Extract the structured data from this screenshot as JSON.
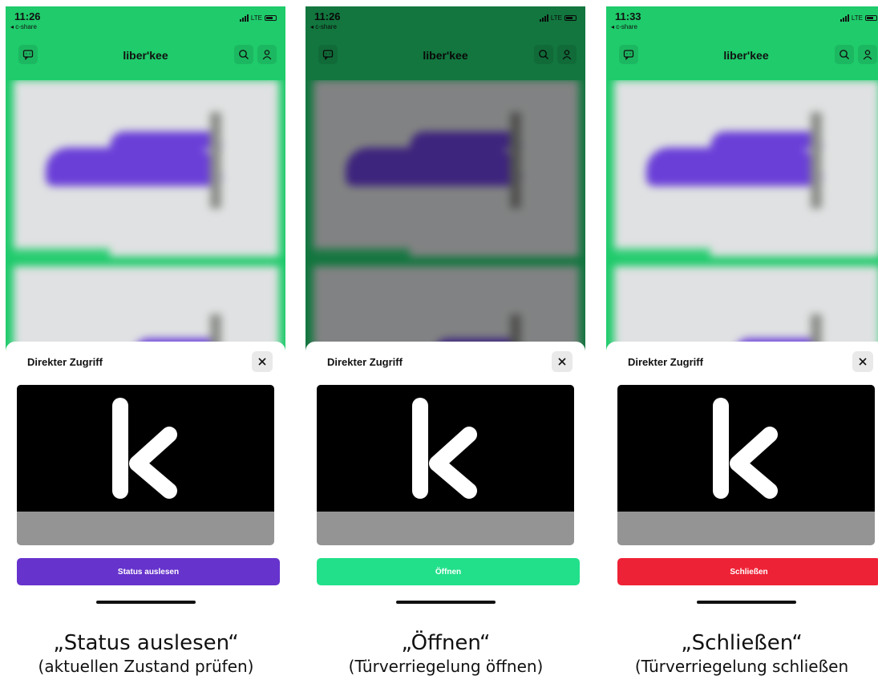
{
  "app": {
    "logo": "liberʹkee",
    "back_label": "◂ c-share",
    "network": "LTE"
  },
  "sheet": {
    "title": "Direkter Zugriff",
    "close_symbol": "✕"
  },
  "screens": [
    {
      "time": "11:26",
      "dimmed": false,
      "action_label": "Status auslesen",
      "action_color": "#6633cc",
      "caption_title": "„Status auslesen“",
      "caption_sub": "(aktuellen Zustand prüfen)"
    },
    {
      "time": "11:26",
      "dimmed": true,
      "action_label": "Öffnen",
      "action_color": "#22e08a",
      "caption_title": "„Öffnen“",
      "caption_sub": "(Türverriegelung öffnen)"
    },
    {
      "time": "11:33",
      "dimmed": false,
      "action_label": "Schließen",
      "action_color": "#ee2236",
      "caption_title": "„Schließen“",
      "caption_sub": "(Türverriegelung schließen"
    }
  ],
  "colors": {
    "brand_green": "#1fcb6b",
    "panel_black": "#000000",
    "panel_grey": "#949494"
  },
  "icons": {
    "time_arrow": "location-arrow-icon",
    "left_nav": "chat-icon",
    "right_nav_1": "search-icon",
    "right_nav_2": "profile-icon",
    "close": "close-icon",
    "panel_logo": "k-logo-icon"
  }
}
